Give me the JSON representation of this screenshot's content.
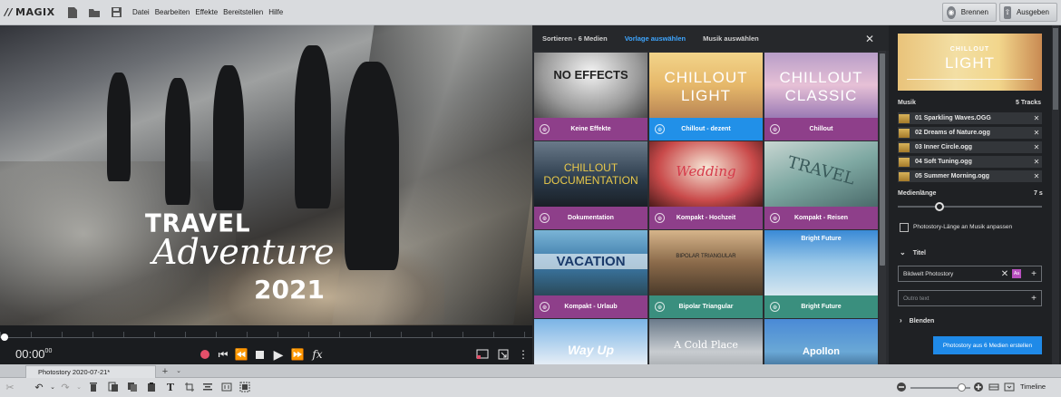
{
  "app": {
    "logo": "MAGIX"
  },
  "menu": [
    "Datei",
    "Bearbeiten",
    "Effekte",
    "Bereitstellen",
    "Hilfe"
  ],
  "top_buttons": {
    "burn": "Brennen",
    "export": "Ausgeben"
  },
  "preview": {
    "title_line1": "TRAVEL",
    "title_line2": "Adventure",
    "title_line3": "2021",
    "time_main": "00:00",
    "time_frames": "00"
  },
  "browser": {
    "tabs": [
      "Sortieren - 6 Medien",
      "Vorlage auswählen",
      "Musik auswählen"
    ],
    "active_tab": 1,
    "templates": [
      {
        "name": "Keine Effekte",
        "thumb": "NO EFFECTS",
        "color": "#8e3f8a",
        "selected": false
      },
      {
        "name": "Chillout - dezent",
        "thumb": "CHILLOUT LIGHT",
        "color": "#2190e8",
        "selected": true
      },
      {
        "name": "Chillout",
        "thumb": "CHILLOUT CLASSIC",
        "color": "#8e3f8a",
        "selected": false
      },
      {
        "name": "Dokumentation",
        "thumb": "CHILLOUT DOCUMENTATION",
        "color": "#8e3f8a",
        "selected": false
      },
      {
        "name": "Kompakt - Hochzeit",
        "thumb": "Wedding",
        "color": "#8e3f8a",
        "selected": false
      },
      {
        "name": "Kompakt - Reisen",
        "thumb": "TRAVEL",
        "color": "#8e3f8a",
        "selected": false
      },
      {
        "name": "Kompakt - Urlaub",
        "thumb": "VACATION",
        "color": "#8e3f8a",
        "selected": false
      },
      {
        "name": "Bipolar Triangular",
        "thumb": "BIPOLAR TRIANGULAR",
        "color": "#3a8f7e",
        "selected": false
      },
      {
        "name": "Bright Future",
        "thumb": "Bright Future",
        "color": "#3a8f7e",
        "selected": false
      },
      {
        "name": "",
        "thumb": "Way Up",
        "color": "#3a8f7e",
        "selected": false
      },
      {
        "name": "",
        "thumb": "A Cold Place",
        "color": "#3a8f7e",
        "selected": false
      },
      {
        "name": "",
        "thumb": "Apollon",
        "color": "#3a8f7e",
        "selected": false
      }
    ]
  },
  "panel": {
    "thumb_line1": "CHILLOUT",
    "thumb_line2": "LIGHT",
    "music_label": "Musik",
    "music_count": "5 Tracks",
    "tracks": [
      "01 Sparkling Waves.OGG",
      "02 Dreams of Nature.ogg",
      "03 Inner Circle.ogg",
      "04 Soft Tuning.ogg",
      "05 Summer Morning.ogg"
    ],
    "length_label": "Medienlänge",
    "length_value": "7 s",
    "fit_checkbox": "Photostory-Länge an Musik anpassen",
    "title_section": "Titel",
    "title_value": "Bildwelt Photostory",
    "title_format_badge": "Aa",
    "outro_placeholder": "Outro text",
    "blend_section": "Blenden",
    "create_button": "Photostory aus 6 Medien erstellen"
  },
  "bottom": {
    "tab": "Photostory 2020-07-21*",
    "timeline_label": "Timeline"
  }
}
